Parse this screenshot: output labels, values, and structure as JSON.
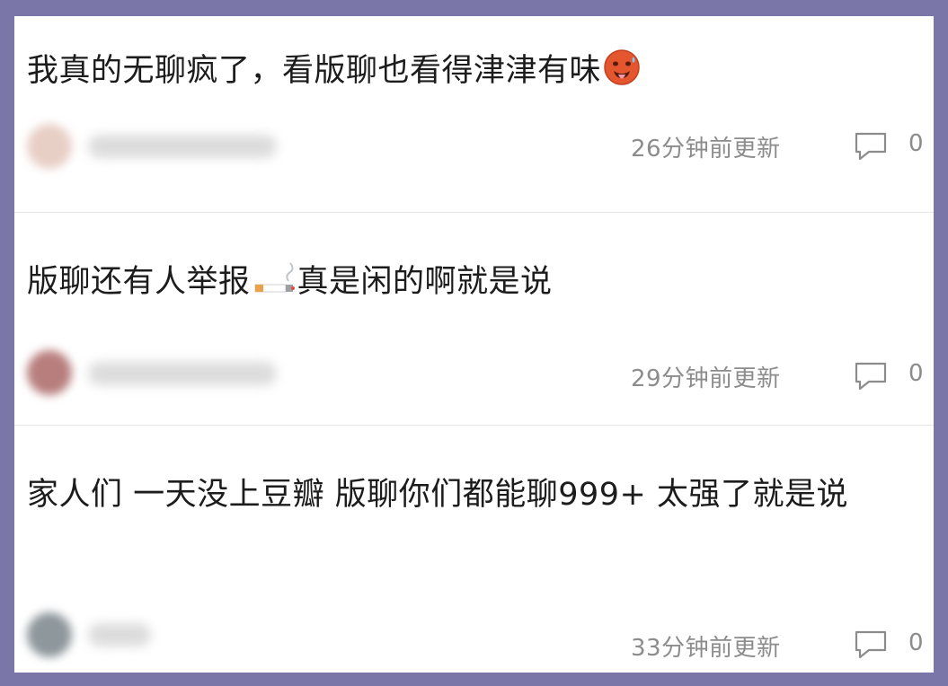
{
  "posts": [
    {
      "title": "我真的无聊疯了，看版聊也看得津津有味",
      "title_emoji": "hot-face-emoji",
      "avatar_color": "#e8cfc6",
      "time": "26分钟前更新",
      "comment_count": "0"
    },
    {
      "title_before": "版聊还有人举报",
      "title_emoji": "cigarette-emoji",
      "title_after": "真是闲的啊就是说",
      "avatar_color": "#b87e7e",
      "time": "29分钟前更新",
      "comment_count": "0"
    },
    {
      "title": "家人们 一天没上豆瓣 版聊你们都能聊999+ 太强了就是说",
      "avatar_color": "#8e979c",
      "time": "33分钟前更新",
      "comment_count": "0"
    }
  ],
  "colors": {
    "background": "#7a76a8",
    "card": "#ffffff",
    "title_text": "#1c1c1c",
    "meta_text": "#8c8c8c",
    "divider": "#e6e6e6"
  }
}
